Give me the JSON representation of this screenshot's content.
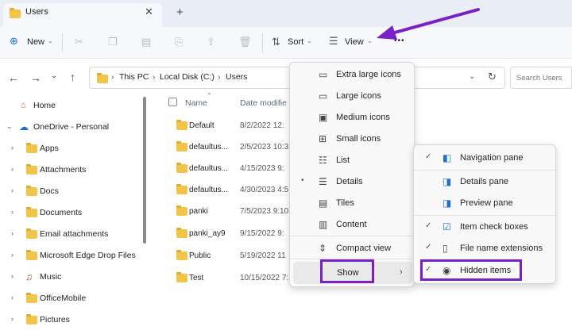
{
  "tab": {
    "title": "Users",
    "close_glyph": "✕",
    "add_glyph": "+"
  },
  "toolbar": {
    "new_label": "New",
    "sort_label": "Sort",
    "view_label": "View",
    "more_glyph": "•••"
  },
  "address": {
    "crumbs": [
      "This PC",
      "Local Disk (C:)",
      "Users"
    ],
    "search_placeholder": "Search Users"
  },
  "sidebar": {
    "items": [
      {
        "label": "Home",
        "icon": "home-icon"
      },
      {
        "label": "OneDrive - Personal",
        "icon": "cloud-icon"
      },
      {
        "label": "Apps",
        "icon": "folder-icon"
      },
      {
        "label": "Attachments",
        "icon": "folder-icon"
      },
      {
        "label": "Docs",
        "icon": "folder-icon"
      },
      {
        "label": "Documents",
        "icon": "folder-icon"
      },
      {
        "label": "Email attachments",
        "icon": "folder-icon"
      },
      {
        "label": "Microsoft Edge Drop Files",
        "icon": "folder-icon"
      },
      {
        "label": "Music",
        "icon": "music-icon"
      },
      {
        "label": "OfficeMobile",
        "icon": "folder-icon"
      },
      {
        "label": "Pictures",
        "icon": "folder-icon"
      }
    ]
  },
  "filelist": {
    "columns": [
      "Name",
      "Date modifie"
    ],
    "rows": [
      {
        "name": "Default",
        "date": "8/2/2022 12:"
      },
      {
        "name": "defaultus...",
        "date": "2/5/2023 10:3"
      },
      {
        "name": "defaultus...",
        "date": "4/15/2023 9:"
      },
      {
        "name": "defaultus...",
        "date": "4/30/2023 4:5"
      },
      {
        "name": "panki",
        "date": "7/5/2023 9:10"
      },
      {
        "name": "panki_ay9",
        "date": "9/15/2022 9:"
      },
      {
        "name": "Public",
        "date": "5/19/2022 11"
      },
      {
        "name": "Test",
        "date": "10/15/2022 7:"
      }
    ]
  },
  "view_menu": {
    "items": [
      {
        "label": "Extra large icons",
        "icon": "monitor-icon"
      },
      {
        "label": "Large icons",
        "icon": "monitor-icon"
      },
      {
        "label": "Medium icons",
        "icon": "medium-icons-icon"
      },
      {
        "label": "Small icons",
        "icon": "small-icons-icon"
      },
      {
        "label": "List",
        "icon": "list-icon"
      },
      {
        "label": "Details",
        "icon": "details-icon",
        "selected": true
      },
      {
        "label": "Tiles",
        "icon": "tiles-icon"
      },
      {
        "label": "Content",
        "icon": "content-icon"
      },
      {
        "label": "Compact view",
        "icon": "compact-view-icon"
      },
      {
        "label": "Show",
        "icon": ""
      }
    ]
  },
  "show_menu": {
    "items": [
      {
        "label": "Navigation pane",
        "icon": "navigation-pane-icon",
        "checked": true
      },
      {
        "label": "Details pane",
        "icon": "details-pane-icon",
        "checked": false
      },
      {
        "label": "Preview pane",
        "icon": "preview-pane-icon",
        "checked": false
      },
      {
        "label": "Item check boxes",
        "icon": "checkbox-icon",
        "checked": true
      },
      {
        "label": "File name extensions",
        "icon": "file-extensions-icon",
        "checked": true
      },
      {
        "label": "Hidden items",
        "icon": "eye-icon",
        "checked": true
      }
    ]
  },
  "colors": {
    "highlight": "#7b1fc7",
    "folder": "#f1c44a"
  }
}
